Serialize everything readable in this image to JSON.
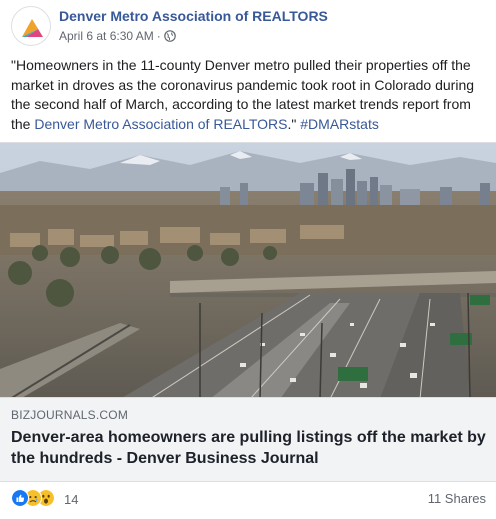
{
  "post": {
    "page_name": "Denver Metro Association of REALTORS",
    "timestamp": "April 6 at 6:30 AM",
    "separator": "·",
    "privacy_icon": "globe-icon",
    "text_before_link": "\"Homeowners in the 11-county Denver metro pulled their properties off the market in droves as the coronavirus pandemic took root in Colorado during the second half of March, according to the latest market trends report from the ",
    "text_link": "Denver Metro Association of REALTORS",
    "text_after_link": ".\" ",
    "hashtag": "#DMARstats"
  },
  "link_preview": {
    "domain": "BIZJOURNALS.COM",
    "title": "Denver-area homeowners are pulling listings off the market by the hundreds - Denver Business Journal"
  },
  "footer": {
    "reaction_icons": [
      "like-icon",
      "sad-icon",
      "wow-icon"
    ],
    "reaction_count": "14",
    "shares": "11 Shares"
  },
  "colors": {
    "link_blue": "#385898",
    "like_blue": "#1877f2",
    "emoji_yellow": "#f7c02b",
    "preview_bg": "#f2f3f5"
  }
}
